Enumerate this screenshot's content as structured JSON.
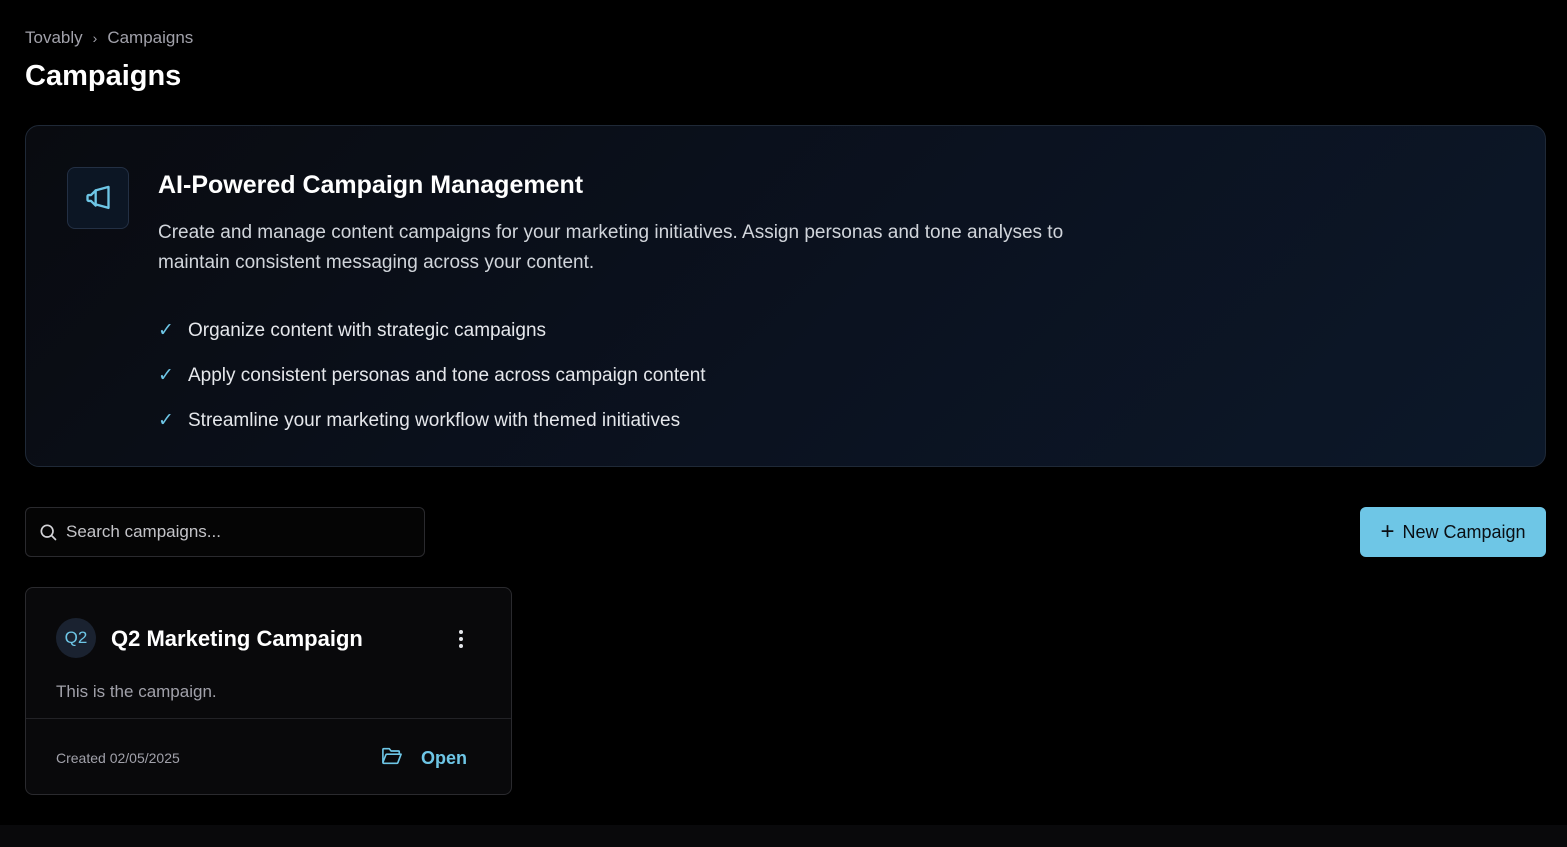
{
  "breadcrumb": {
    "root": "Tovably",
    "separator": "›",
    "current": "Campaigns"
  },
  "page": {
    "title": "Campaigns"
  },
  "hero": {
    "icon": "megaphone-icon",
    "title": "AI-Powered Campaign Management",
    "description": "Create and manage content campaigns for your marketing initiatives. Assign personas and tone analyses to maintain consistent messaging across your content.",
    "check_glyph": "✓",
    "features": [
      "Organize content with strategic campaigns",
      "Apply consistent personas and tone across campaign content",
      "Streamline your marketing workflow with themed initiatives"
    ]
  },
  "toolbar": {
    "search_placeholder": "Search campaigns...",
    "search_value": "",
    "new_button_label": "New Campaign",
    "new_button_icon": "+"
  },
  "campaigns": [
    {
      "badge": "Q2",
      "title": "Q2 Marketing Campaign",
      "description": "This is the campaign.",
      "created": "Created 02/05/2025",
      "open_label": "Open"
    }
  ],
  "colors": {
    "accent": "#6ec6e6",
    "background": "#000000",
    "card": "#09090b"
  }
}
